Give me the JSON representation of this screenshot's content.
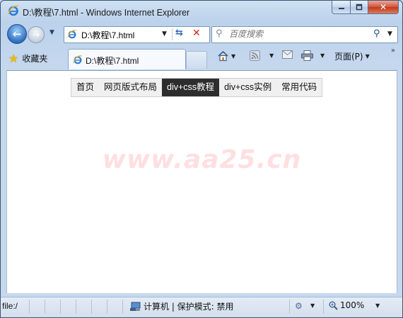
{
  "window": {
    "title": "D:\\教程\\7.html - Windows Internet Explorer",
    "caption_buttons": [
      "minimize",
      "maximize",
      "close"
    ]
  },
  "navigation": {
    "address": "D:\\教程\\7.html",
    "search_placeholder": "百度搜索"
  },
  "tabs": {
    "favorites_label": "收藏夹",
    "active_tab_label": "D:\\教程\\7.html"
  },
  "command_bar": {
    "page_label": "页面(P)"
  },
  "page": {
    "menu": [
      {
        "label": "首页",
        "active": false
      },
      {
        "label": "网页版式布局",
        "active": false
      },
      {
        "label": "div+css教程",
        "active": true
      },
      {
        "label": "div+css实例",
        "active": false
      },
      {
        "label": "常用代码",
        "active": false
      }
    ],
    "watermark": "www.aa25.cn"
  },
  "status_bar": {
    "status_text": "file:/",
    "zone_label": "计算机 | 保护模式: 禁用",
    "zoom_label": "100%"
  },
  "colors": {
    "menu_active_bg": "#2d2d2d",
    "menu_bg": "#f0f0f0",
    "watermark": "#ff505a"
  }
}
